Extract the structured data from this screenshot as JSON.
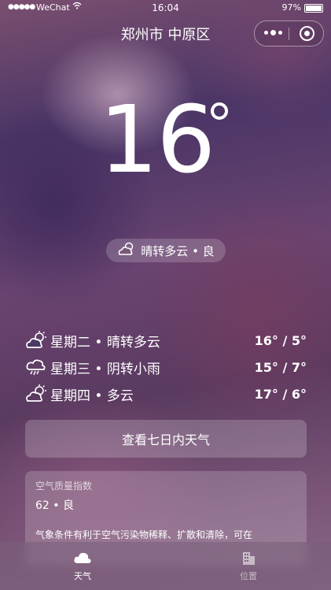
{
  "status_bar": {
    "signal": "●●●●●",
    "carrier": "WeChat",
    "time": "16:04",
    "battery_percent": "97%"
  },
  "nav": {
    "title": "郑州市 中原区",
    "more_icon": "more-dots-icon",
    "close_icon": "target-close-icon"
  },
  "current": {
    "temperature": "16",
    "condition": "晴转多云 • 良",
    "condition_icon": "cloud-sun-icon"
  },
  "forecast": [
    {
      "icon": "cloud-sun-icon",
      "desc": "星期二 • 晴转多云",
      "range": "16° / 5°"
    },
    {
      "icon": "cloud-rain-icon",
      "desc": "星期三 • 阴转小雨",
      "range": "15° / 7°"
    },
    {
      "icon": "cloud-sun-icon",
      "desc": "星期四 • 多云",
      "range": "17° / 6°"
    }
  ],
  "seven_day_button": "查看七日内天气",
  "aqi": {
    "label": "空气质量指数",
    "value": "62 • 良",
    "advice": "气象条件有利于空气污染物稀释、扩散和清除，可在"
  },
  "tabbar": {
    "items": [
      {
        "label": "天气",
        "icon": "cloud-icon",
        "active": true
      },
      {
        "label": "位置",
        "icon": "building-icon",
        "active": false
      }
    ]
  }
}
